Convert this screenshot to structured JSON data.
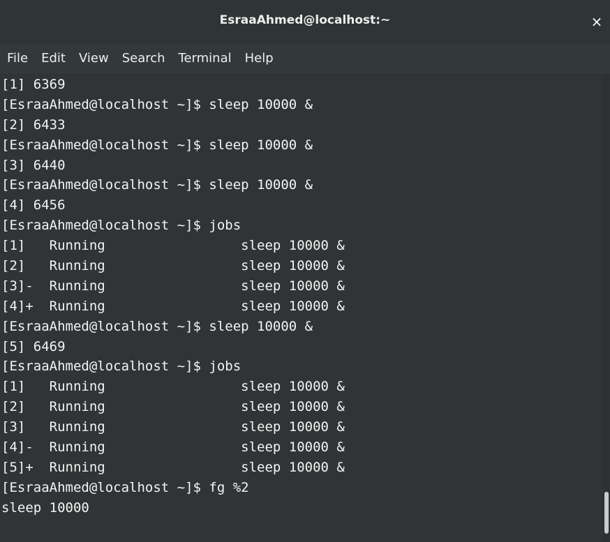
{
  "window": {
    "title": "EsraaAhmed@localhost:~",
    "close_glyph": "×"
  },
  "menu": {
    "items": [
      "File",
      "Edit",
      "View",
      "Search",
      "Terminal",
      "Help"
    ]
  },
  "terminal": {
    "lines": [
      "[1] 6369",
      "[EsraaAhmed@localhost ~]$ sleep 10000 &",
      "[2] 6433",
      "[EsraaAhmed@localhost ~]$ sleep 10000 &",
      "[3] 6440",
      "[EsraaAhmed@localhost ~]$ sleep 10000 &",
      "[4] 6456",
      "[EsraaAhmed@localhost ~]$ jobs",
      "[1]   Running                 sleep 10000 &",
      "[2]   Running                 sleep 10000 &",
      "[3]-  Running                 sleep 10000 &",
      "[4]+  Running                 sleep 10000 &",
      "[EsraaAhmed@localhost ~]$ sleep 10000 &",
      "[5] 6469",
      "[EsraaAhmed@localhost ~]$ jobs",
      "[1]   Running                 sleep 10000 &",
      "[2]   Running                 sleep 10000 &",
      "[3]   Running                 sleep 10000 &",
      "[4]-  Running                 sleep 10000 &",
      "[5]+  Running                 sleep 10000 &",
      "[EsraaAhmed@localhost ~]$ fg %2",
      "sleep 10000"
    ]
  },
  "colors": {
    "titlebar_bg": "#2f3436",
    "menubar_bg": "#33393b",
    "terminal_bg": "#303436",
    "terminal_fg": "#f4f4f2"
  }
}
